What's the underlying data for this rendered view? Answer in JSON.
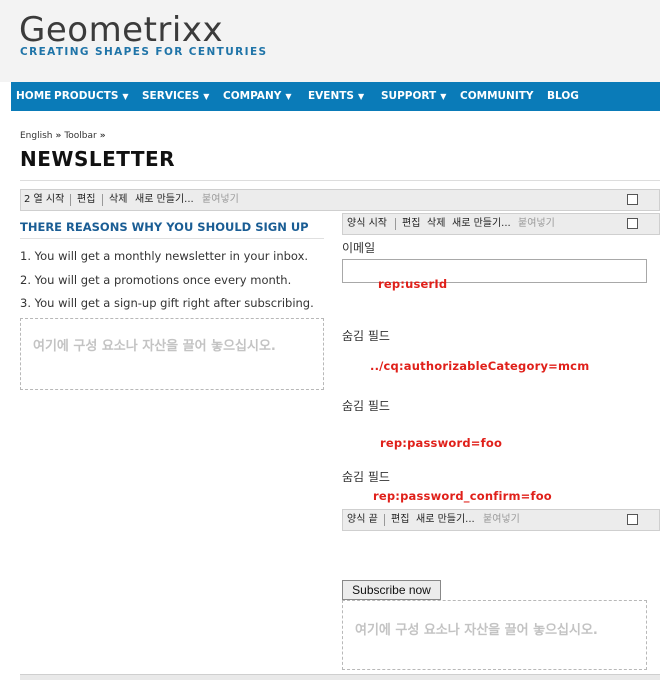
{
  "header": {
    "logo_title": "Geometrixx",
    "logo_subtitle": "CREATING SHAPES FOR CENTURIES"
  },
  "nav": {
    "items": [
      {
        "label": "HOME",
        "caret": false
      },
      {
        "label": "PRODUCTS",
        "caret": true
      },
      {
        "label": "SERVICES",
        "caret": true
      },
      {
        "label": "COMPANY",
        "caret": true
      },
      {
        "label": "EVENTS",
        "caret": true
      },
      {
        "label": "SUPPORT",
        "caret": true
      },
      {
        "label": "COMMUNITY",
        "caret": false
      },
      {
        "label": "BLOG",
        "caret": false
      }
    ],
    "caret_glyph": "▼"
  },
  "breadcrumb": {
    "items": [
      "English",
      "Toolbar"
    ],
    "separator": "»"
  },
  "page_title": "NEWSLETTER",
  "column_bar": {
    "start": "2 열 시작",
    "edit": "편집",
    "delete": "삭제",
    "new": "새로 만들기...",
    "paste": "붙여넣기"
  },
  "form_start_bar": {
    "start": "양식 시작",
    "edit": "편집",
    "delete": "삭제",
    "new": "새로 만들기...",
    "paste": "붙여넣기"
  },
  "form_end_bar": {
    "end": "양식 끝",
    "edit": "편집",
    "new": "새로 만들기...",
    "paste": "붙여넣기"
  },
  "left": {
    "reasons_title": "THERE REASONS WHY YOU SHOULD SIGN UP",
    "reasons": [
      "1. You will get a monthly newsletter in your inbox.",
      "2. You will get a promotions once every month.",
      "3. You will get a sign-up gift right after subscribing."
    ],
    "dropzone_text": "여기에 구성 요소나 자산을 끌어 놓으십시오."
  },
  "form": {
    "email_label": "이메일",
    "email_value": "",
    "userid_annotation": "rep:userId",
    "hidden_fields": [
      {
        "label": "숨김 필드",
        "annotation": "../cq:authorizableCategory=mcm"
      },
      {
        "label": "숨김 필드",
        "annotation": "rep:password=foo"
      },
      {
        "label": "숨김 필드",
        "annotation": "rep:password_confirm=foo"
      }
    ],
    "subscribe_label": "Subscribe now",
    "dropzone_text": "여기에 구성 요소나 자산을 끌어 놓으십시오."
  },
  "colors": {
    "nav_bg": "#0a7bb8",
    "title_blue": "#1a5d94",
    "annotation_red": "#e0201a"
  }
}
